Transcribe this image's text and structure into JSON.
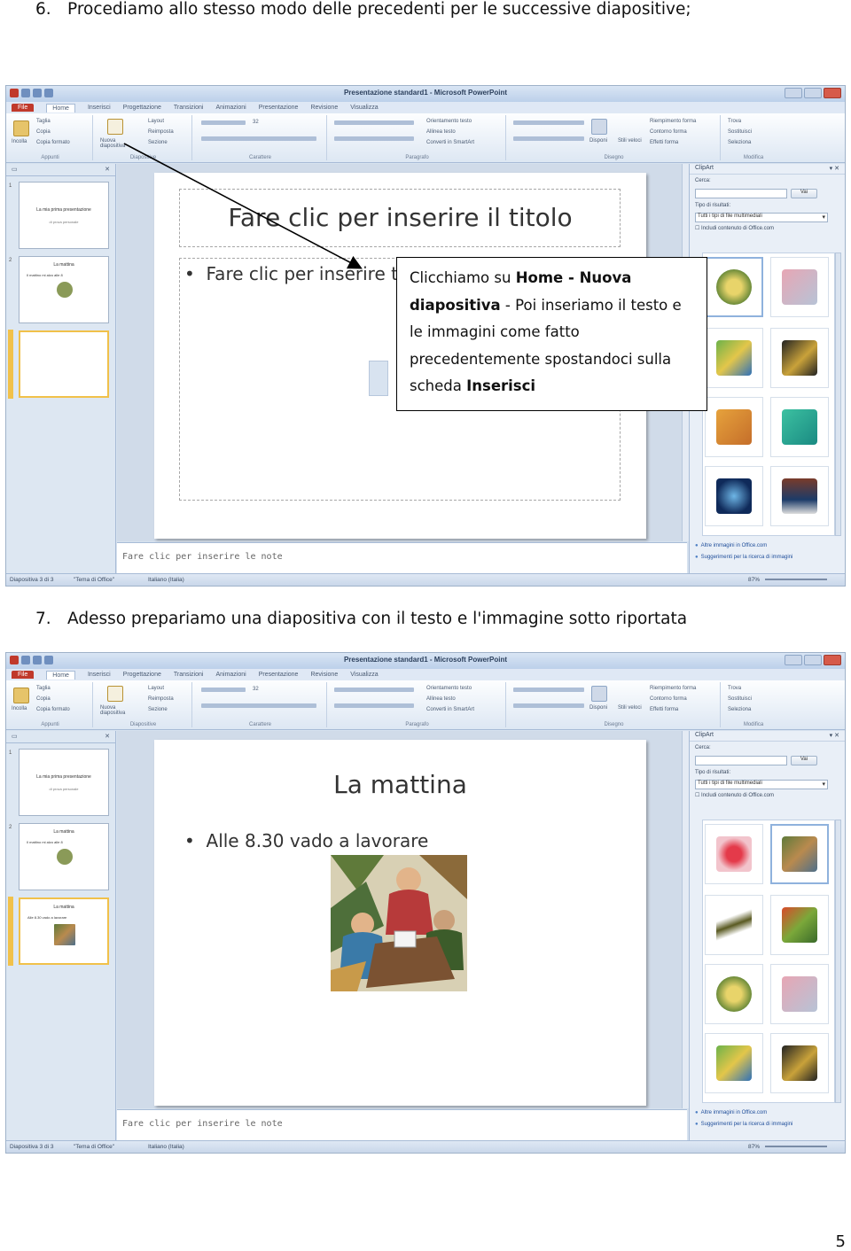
{
  "steps": [
    {
      "num": "6.",
      "text": "Procediamo allo stesso modo delle precedenti per le successive diapositive;"
    },
    {
      "num": "7.",
      "text": "Adesso prepariamo una diapositiva con il testo e l'immagine sotto riportata"
    }
  ],
  "window": {
    "title": "Presentazione standard1 - Microsoft PowerPoint",
    "tabs": [
      "File",
      "Home",
      "Inserisci",
      "Progettazione",
      "Transizioni",
      "Animazioni",
      "Presentazione",
      "Revisione",
      "Visualizza"
    ]
  },
  "ribbon": {
    "groups": [
      "Appunti",
      "Diapositive",
      "Carattere",
      "Paragrafo",
      "Disegno",
      "Modifica"
    ],
    "paste": "Incolla",
    "cut": "Taglia",
    "copy": "Copia",
    "format_painter": "Copia formato",
    "new_slide": "Nuova diapositiva",
    "layout": "Layout",
    "reset": "Reimposta",
    "section": "Sezione",
    "font_size": "32",
    "text_direction": "Orientamento testo",
    "align_text": "Allinea testo",
    "smartart": "Converti in SmartArt",
    "arrange": "Disponi",
    "quick_styles": "Stili veloci",
    "shape_fill": "Riempimento forma",
    "shape_outline": "Contorno forma",
    "shape_effects": "Effetti forma",
    "find": "Trova",
    "replace": "Sostituisci",
    "select": "Seleziona"
  },
  "clipart": {
    "pane_title": "ClipArt",
    "search_label": "Cerca:",
    "search_value": "",
    "go_button": "Vai",
    "results_label": "Tipo di risultati:",
    "results_value": "Tutti i tipi di file multimediali",
    "include_office": "Includi contenuto di Office.com",
    "link_more": "Altre immagini in Office.com",
    "link_tips": "Suggerimenti per la ricerca di immagini"
  },
  "screenshot1": {
    "slide_title": "Fare clic per inserire il titolo",
    "slide_body": "Fare clic per inserire te",
    "notes": "Fare clic per inserire le note",
    "status_slide": "Diapositiva 3 di 3",
    "status_theme": "\"Tema di Office\"",
    "status_lang": "Italiano (Italia)",
    "zoom": "87%",
    "thumbs": [
      {
        "num": "1",
        "title": "La mia prima presentazione",
        "sub": "di prova personale"
      },
      {
        "num": "2",
        "title": "La mattina",
        "bullet": "Il mattino mi alzo alle 8"
      },
      {
        "num": "3",
        "title": "",
        "bullet": ""
      }
    ]
  },
  "callout": {
    "t1": "Clicchiamo su ",
    "b1": "Home - Nuova diapositiva",
    "t2": " - Poi inseriamo il testo e le immagini come fatto precedentemente spostandoci sulla scheda ",
    "b2": "Inserisci"
  },
  "screenshot2": {
    "slide_title": "La mattina",
    "slide_body": "Alle 8.30 vado a lavorare",
    "notes": "Fare clic per inserire le note",
    "status_slide": "Diapositiva 3 di 3",
    "status_theme": "\"Tema di Office\"",
    "status_lang": "Italiano (Italia)",
    "zoom": "87%",
    "thumbs": [
      {
        "num": "1",
        "title": "La mia prima presentazione",
        "sub": "di prova personale"
      },
      {
        "num": "2",
        "title": "La mattina",
        "bullet": "Il mattino mi alzo alle 8"
      },
      {
        "num": "3",
        "title": "La mattina",
        "bullet": "Alle 8.30 vado a lavorare"
      }
    ]
  },
  "colors": {
    "ribbon_file": "#c0392b",
    "selection": "#f1c14a",
    "link": "#1f4e9a"
  },
  "page_number": "5"
}
